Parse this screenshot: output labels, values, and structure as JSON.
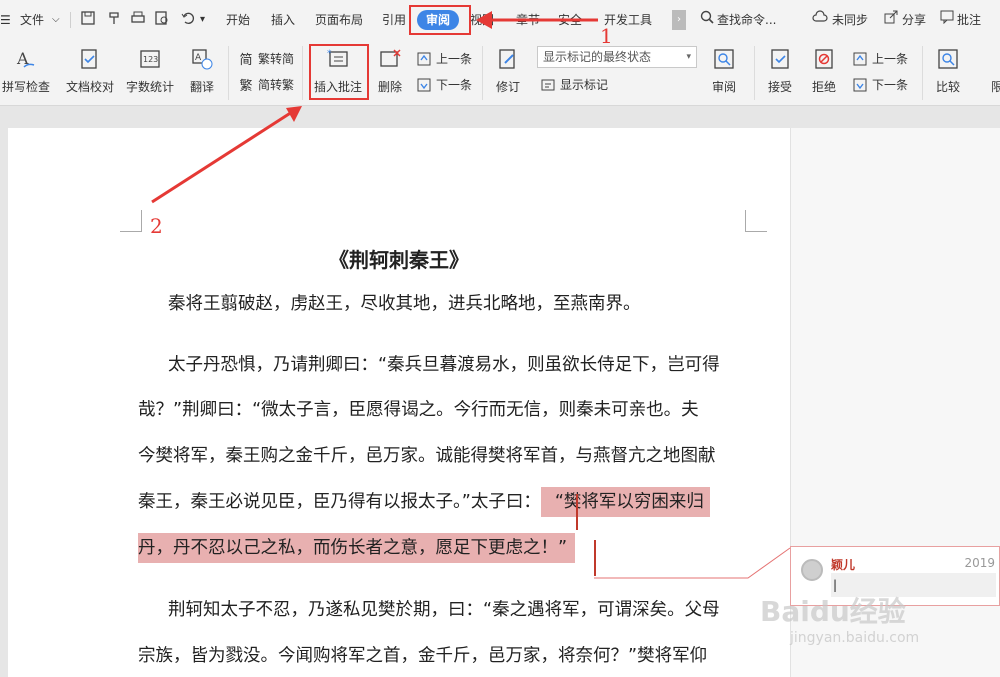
{
  "menubar": {
    "file": "文件",
    "items": [
      "开始",
      "插入",
      "页面布局",
      "引用",
      "审阅",
      "视图",
      "章节",
      "安全",
      "开发工具"
    ],
    "active_tab": "审阅",
    "search": "查找命令...",
    "sync": "未同步",
    "share": "分享",
    "comment": "批注"
  },
  "ribbon": {
    "spell_check": "拼写检查",
    "doc_proof": "文档校对",
    "word_count": "字数统计",
    "translate": "翻译",
    "trad_to_simp": "繁转简",
    "simp_to_trad": "简转繁",
    "insert_comment": "插入批注",
    "delete": "删除",
    "prev": "上一条",
    "next": "下一条",
    "revise": "修订",
    "display_state": "显示标记的最终状态",
    "show_marks": "显示标记",
    "review": "审阅",
    "accept": "接受",
    "reject": "拒绝",
    "prev2": "上一条",
    "next2": "下一条",
    "compare": "比较",
    "limit": "限"
  },
  "document": {
    "title": "《荆轲刺秦王》",
    "lines": [
      "秦将王翦破赵，虏赵王，尽收其地，进兵北略地，至燕南界。",
      "太子丹恐惧，乃请荆卿曰：“秦兵旦暮渡易水，则虽欲长侍足下，岂可得",
      "哉？”荆卿曰：“微太子言，臣愿得谒之。今行而无信，则秦未可亲也。夫",
      "今樊将军，秦王购之金千斤，邑万家。诚能得樊将军首，与燕督亢之地图献",
      "秦王，秦王必说见臣，臣乃得有以报太子。”太子曰：",
      "“樊将军以穷困来归",
      "丹，丹不忍以己之私，而伤长者之意，愿足下更虑之！”",
      "荆轲知太子不忍，乃遂私见樊於期，曰：“秦之遇将军，可谓深矣。父母",
      "宗族，皆为戮没。今闻购将军之首，金千斤，邑万家，将奈何？”樊将军仰"
    ]
  },
  "comment": {
    "author": "颖儿",
    "date": "2019",
    "text": "|"
  },
  "annotations": {
    "num1": "1",
    "num2": "2"
  },
  "watermark": {
    "main": "Baidu经验",
    "sub": "jingyan.baidu.com"
  }
}
